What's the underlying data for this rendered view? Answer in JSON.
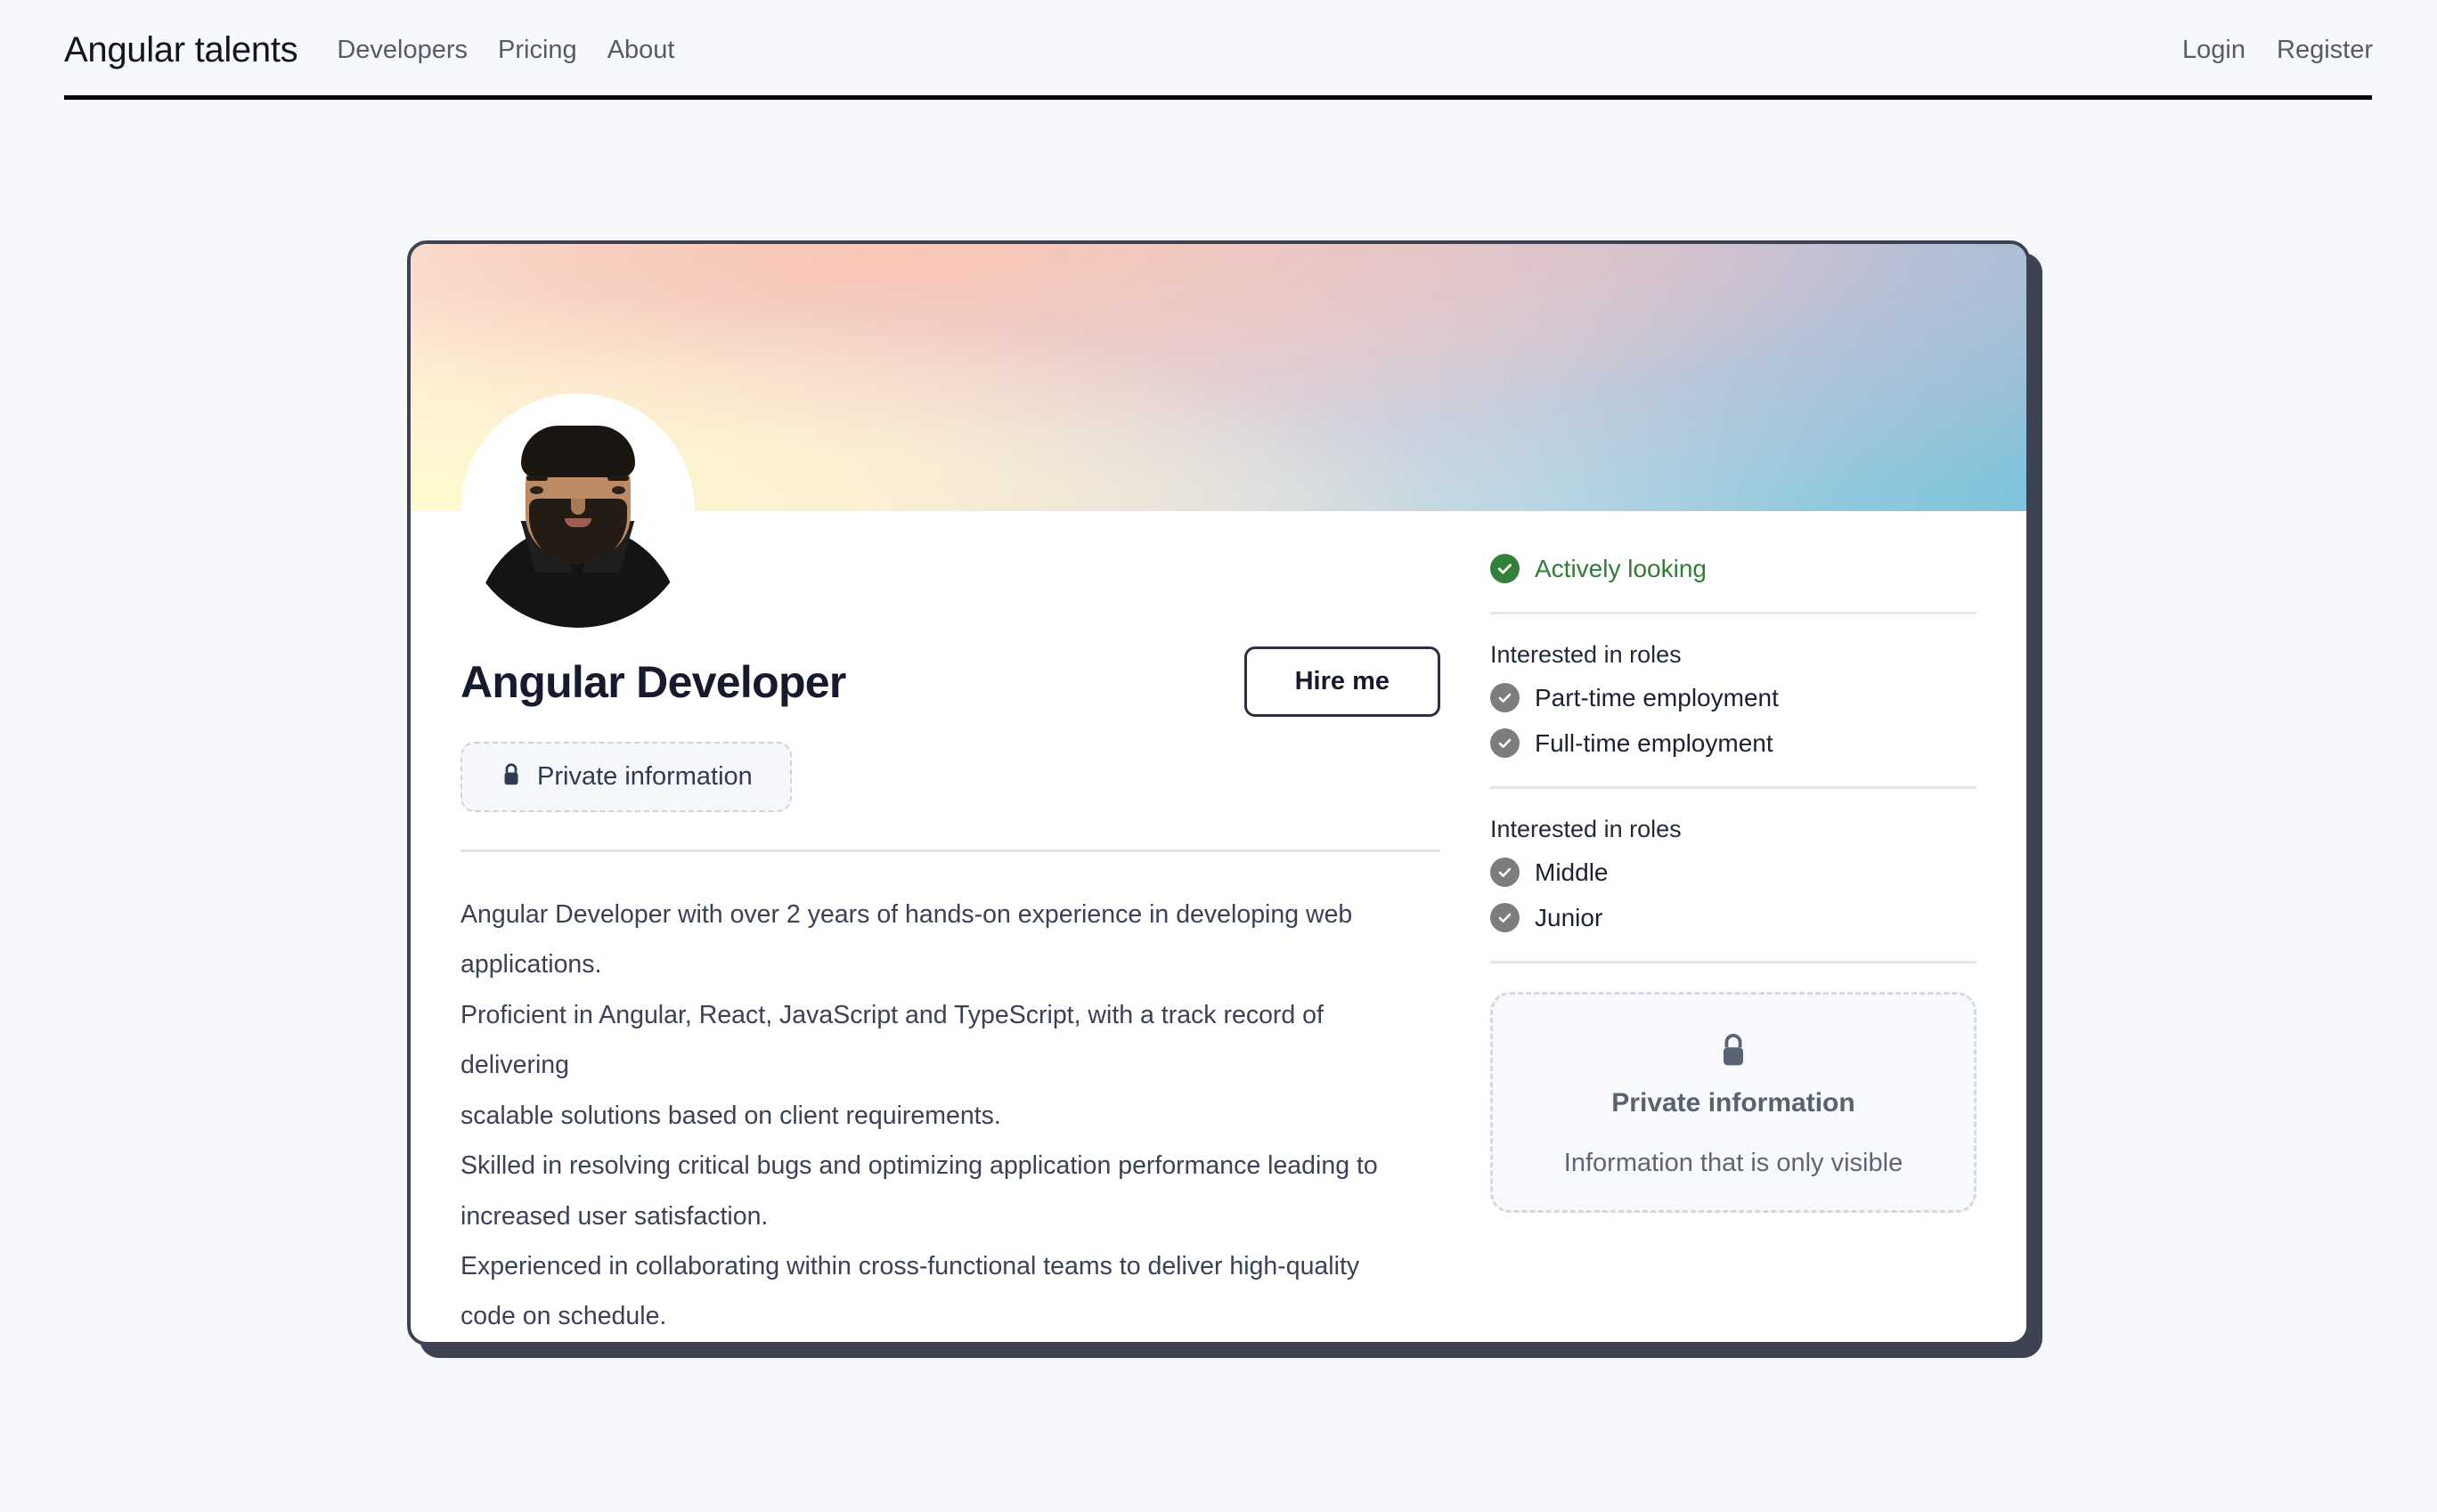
{
  "header": {
    "brand": "Angular talents",
    "nav": [
      {
        "label": "Developers"
      },
      {
        "label": "Pricing"
      },
      {
        "label": "About"
      }
    ],
    "auth": [
      {
        "label": "Login"
      },
      {
        "label": "Register"
      }
    ]
  },
  "profile": {
    "title": "Angular Developer",
    "hire_label": "Hire me",
    "private_pill": {
      "icon": "lock-icon",
      "label": "Private information"
    },
    "bio": "Angular Developer with over 2 years of hands-on experience in developing web\napplications.\nProficient in Angular, React, JavaScript and TypeScript, with a track record of delivering\nscalable solutions based on client requirements.\nSkilled in resolving critical bugs and optimizing application performance leading to\nincreased user satisfaction.\nExperienced in collaborating within cross-functional teams to deliver high-quality code on schedule."
  },
  "sidebar": {
    "status": {
      "icon": "check-circle-icon",
      "label": "Actively looking",
      "color": "#2f7d32"
    },
    "employment_section": {
      "heading": "Interested in roles",
      "items": [
        {
          "icon": "check-circle-icon",
          "label": "Part-time employment"
        },
        {
          "icon": "check-circle-icon",
          "label": "Full-time employment"
        }
      ]
    },
    "seniority_section": {
      "heading": "Interested in roles",
      "items": [
        {
          "icon": "check-circle-icon",
          "label": "Middle"
        },
        {
          "icon": "check-circle-icon",
          "label": "Junior"
        }
      ]
    },
    "private_box": {
      "icon": "lock-icon",
      "title": "Private information",
      "description": "Information that is only visible"
    }
  },
  "colors": {
    "page_background": "#f6f8fc",
    "card_border": "#3d4352",
    "accent_green": "#33803a",
    "muted_grey": "#7d7d7d",
    "title": "#151b2c"
  }
}
